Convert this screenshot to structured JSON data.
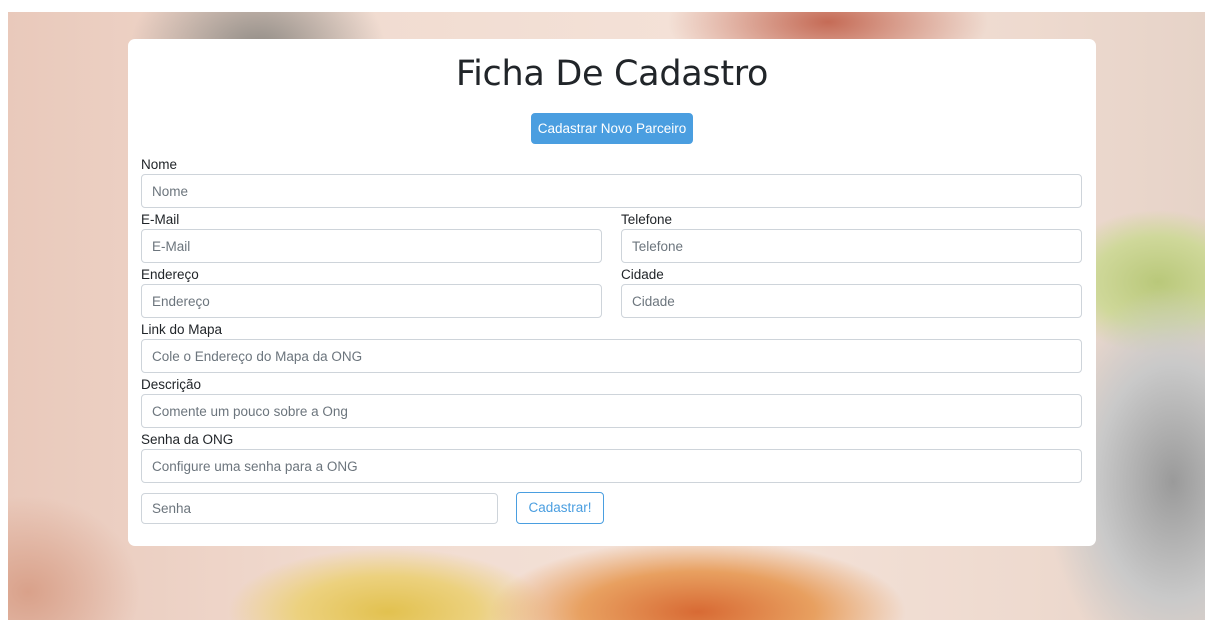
{
  "form": {
    "title": "Ficha De Cadastro",
    "new_partner_button": "Cadastrar Novo Parceiro",
    "fields": {
      "nome": {
        "label": "Nome",
        "placeholder": "Nome"
      },
      "email": {
        "label": "E-Mail",
        "placeholder": "E-Mail"
      },
      "telefone": {
        "label": "Telefone",
        "placeholder": "Telefone"
      },
      "endereco": {
        "label": "Endereço",
        "placeholder": "Endereço"
      },
      "cidade": {
        "label": "Cidade",
        "placeholder": "Cidade"
      },
      "link_mapa": {
        "label": "Link do Mapa",
        "placeholder": "Cole o Endereço do Mapa da ONG"
      },
      "descricao": {
        "label": "Descrição",
        "placeholder": "Comente um pouco sobre a Ong"
      },
      "senha_ong": {
        "label": "Senha da ONG",
        "placeholder": "Configure uma senha para a ONG"
      },
      "senha": {
        "placeholder": "Senha"
      }
    },
    "submit_button": "Cadastrar!"
  },
  "colors": {
    "primary": "#4a9ee0",
    "card_background": "#ffffff",
    "input_border": "#ced4da"
  }
}
